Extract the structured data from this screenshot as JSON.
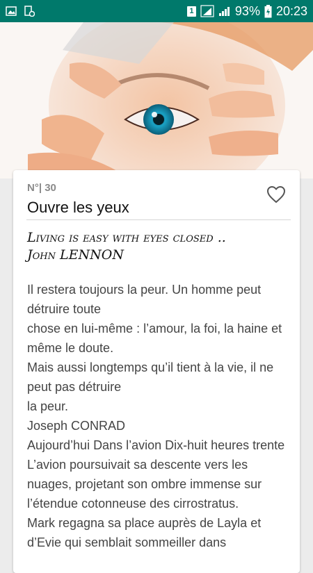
{
  "status_bar": {
    "icons_left": [
      "image-icon",
      "device-alert-icon"
    ],
    "sim_label": "1",
    "battery_percent": "93%",
    "time": "20:23"
  },
  "hero": {
    "description_icon": "eye-hands-illustration"
  },
  "card": {
    "number_label": "N°| 30",
    "title": "Ouvre les yeux",
    "quote_line1": "Living is easy with eyes closed ..",
    "quote_line2": "John LENNON",
    "body_lines": [
      "Il restera toujours la peur. Un homme peut détruire toute",
      "chose en lui-même : l’amour, la foi, la haine et même le doute.",
      "Mais aussi longtemps qu’il tient à la vie, il ne peut pas détruire",
      "la peur.",
      "Joseph CONRAD",
      "Aujourd’hui Dans l’avion Dix-huit heures trente",
      "L’avion poursuivait sa descente vers les nuages, projetant son ombre immense sur l’étendue cotonneuse des cirrostratus.",
      "Mark regagna sa place auprès de Layla et d’Evie qui semblait sommeiller dans"
    ]
  },
  "colors": {
    "status_bar": "#00796b",
    "background": "#ececec",
    "card": "#ffffff"
  }
}
